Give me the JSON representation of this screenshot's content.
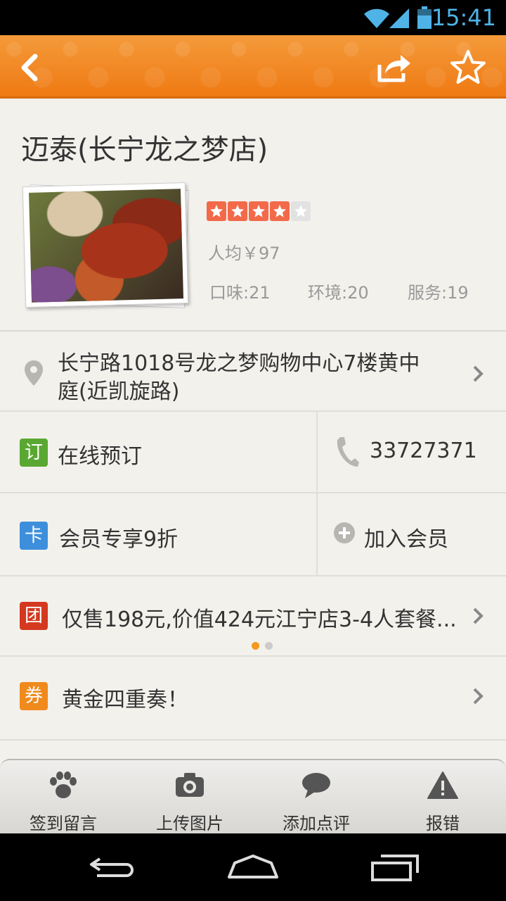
{
  "status_bar": {
    "time": "15:41"
  },
  "titlebar": {
    "back_icon": "back-arrow-icon",
    "share_icon": "share-icon",
    "favorite_icon": "star-outline-icon"
  },
  "shop": {
    "name": "迈泰(长宁龙之梦店)",
    "rating_stars": 4,
    "rating_max": 5,
    "avg_price": "人均￥97",
    "taste": "口味:21",
    "environment": "环境:20",
    "service": "服务:19"
  },
  "address": {
    "line1": "长宁路1018号龙之梦购物中心7楼黄中",
    "line2": "庭(近凯旋路)"
  },
  "booking": {
    "tag": "订",
    "label": "在线预订",
    "tag_color": "#5aa832"
  },
  "phone": {
    "number": "33727371"
  },
  "member": {
    "tag": "卡",
    "label": "会员专享9折",
    "tag_color": "#3d8fdc",
    "join_label": "加入会员"
  },
  "deal": {
    "tag": "团",
    "label": "仅售198元,价值424元江宁店3-4人套餐...",
    "tag_color": "#d4391f"
  },
  "coupon": {
    "tag": "券",
    "label": "黄金四重奏！",
    "tag_color": "#f08a1c"
  },
  "toolbar": [
    {
      "icon": "paw-icon",
      "label": "签到留言"
    },
    {
      "icon": "camera-icon",
      "label": "上传图片"
    },
    {
      "icon": "speech-bubble-icon",
      "label": "添加点评"
    },
    {
      "icon": "warning-icon",
      "label": "报错"
    }
  ],
  "colors": {
    "brand": "#ef7a13",
    "star": "#f26a4a",
    "dot_active": "#f39a1e"
  }
}
